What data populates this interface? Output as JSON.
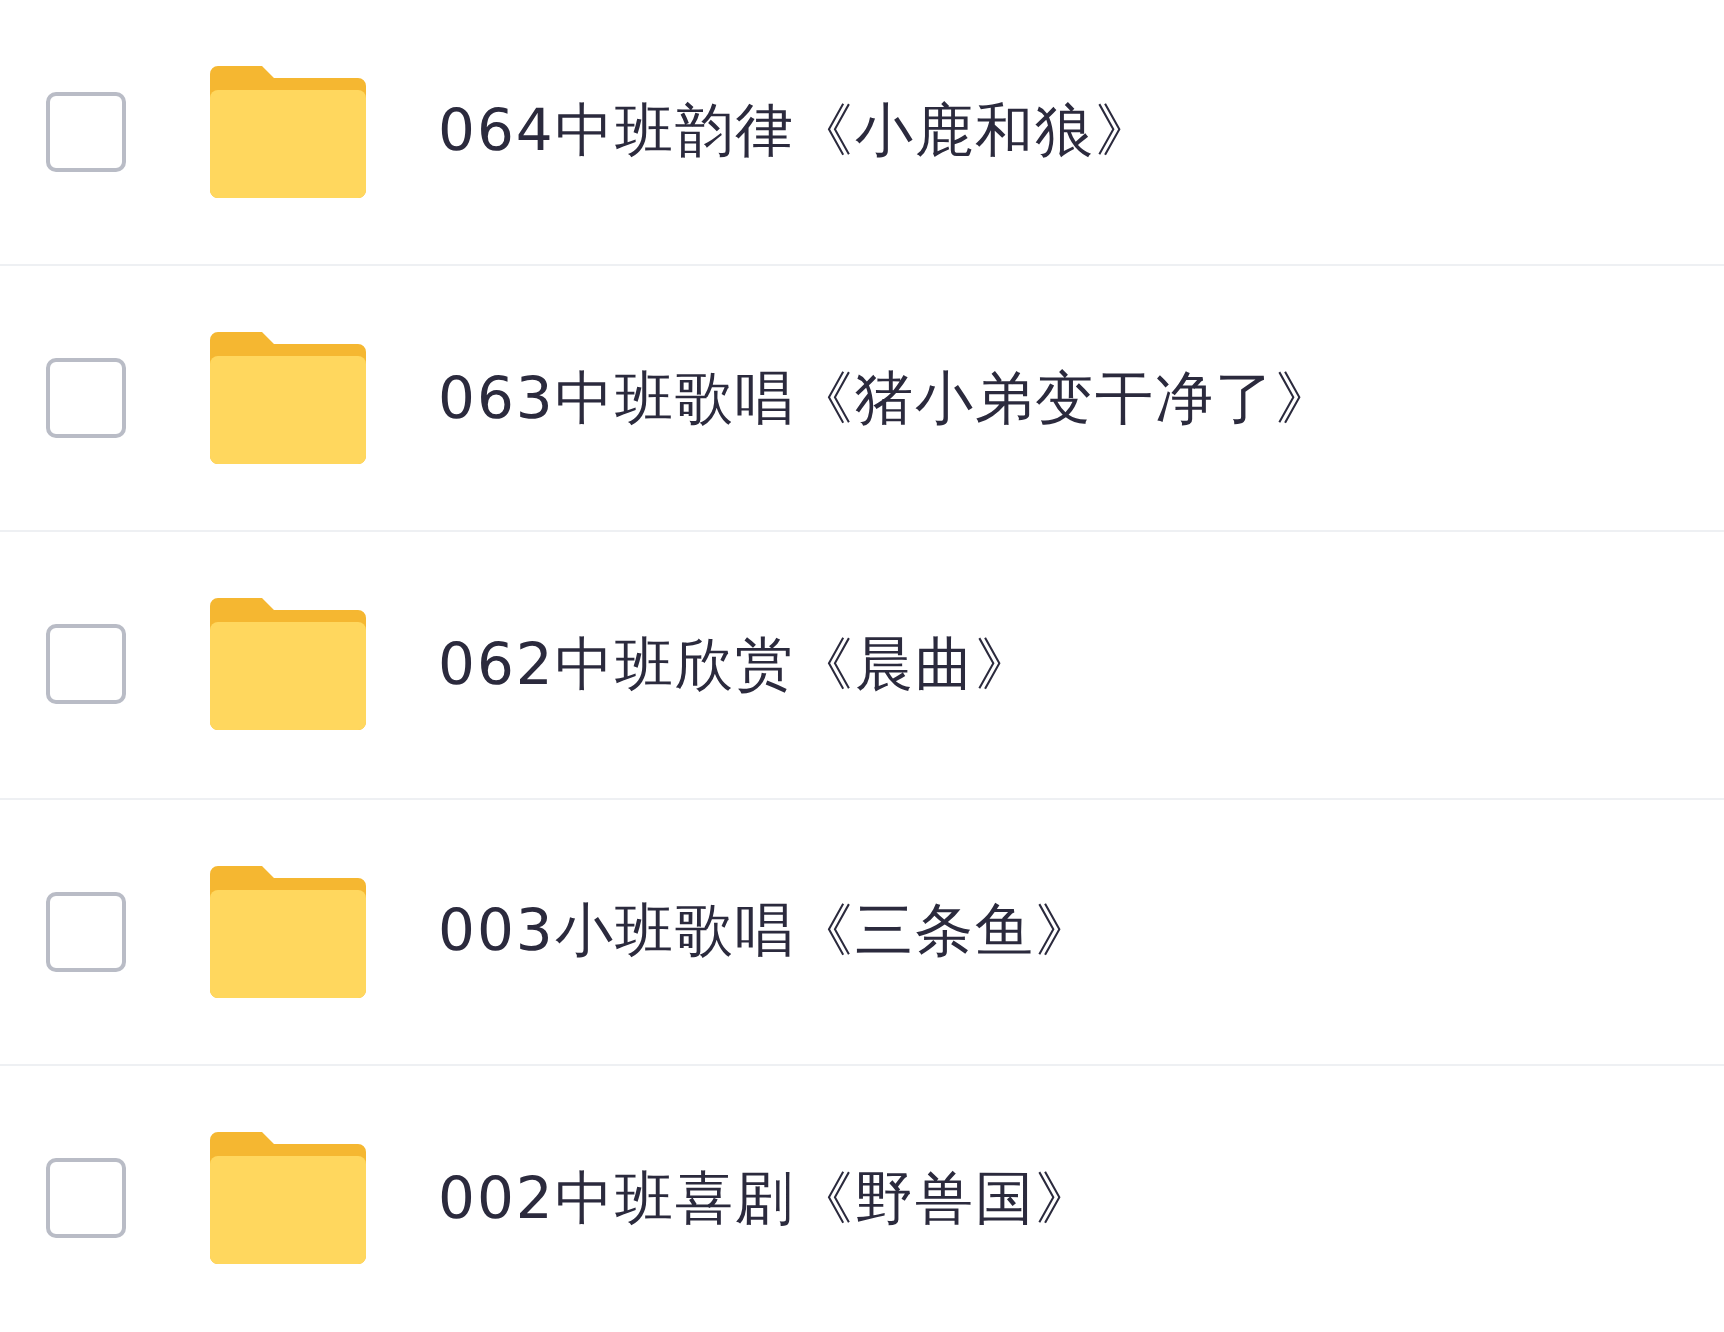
{
  "files": [
    {
      "name": "064中班韵律《小鹿和狼》",
      "checked": false
    },
    {
      "name": "063中班歌唱《猪小弟变干净了》",
      "checked": false
    },
    {
      "name": "062中班欣赏《晨曲》",
      "checked": false
    },
    {
      "name": "003小班歌唱《三条鱼》",
      "checked": false
    },
    {
      "name": "002中班喜剧《野兽国》",
      "checked": false
    }
  ]
}
